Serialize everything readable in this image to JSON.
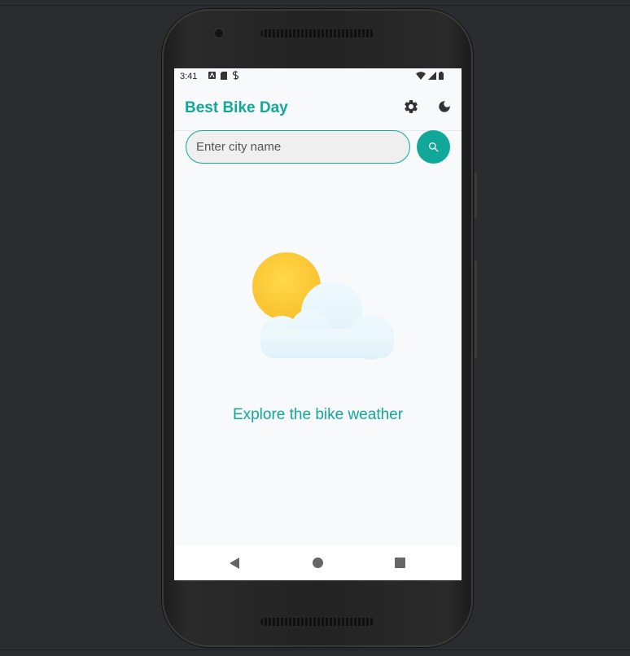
{
  "colors": {
    "accent": "#12a899",
    "screen_bg": "#f7f9fb",
    "input_bg": "#efefef",
    "sun": "#fdcb3b",
    "cloud": "#e6f5fb"
  },
  "status_bar": {
    "time": "3:41"
  },
  "app_bar": {
    "title": "Best Bike Day",
    "icons": [
      "gear-icon",
      "moon-icon"
    ]
  },
  "search": {
    "placeholder": "Enter city name",
    "value": "",
    "button_icon": "search-icon"
  },
  "empty_state": {
    "illustration": "sun-behind-cloud",
    "message": "Explore the bike weather"
  },
  "nav_bar": {
    "items": [
      "back-icon",
      "home-icon",
      "recents-icon"
    ]
  }
}
